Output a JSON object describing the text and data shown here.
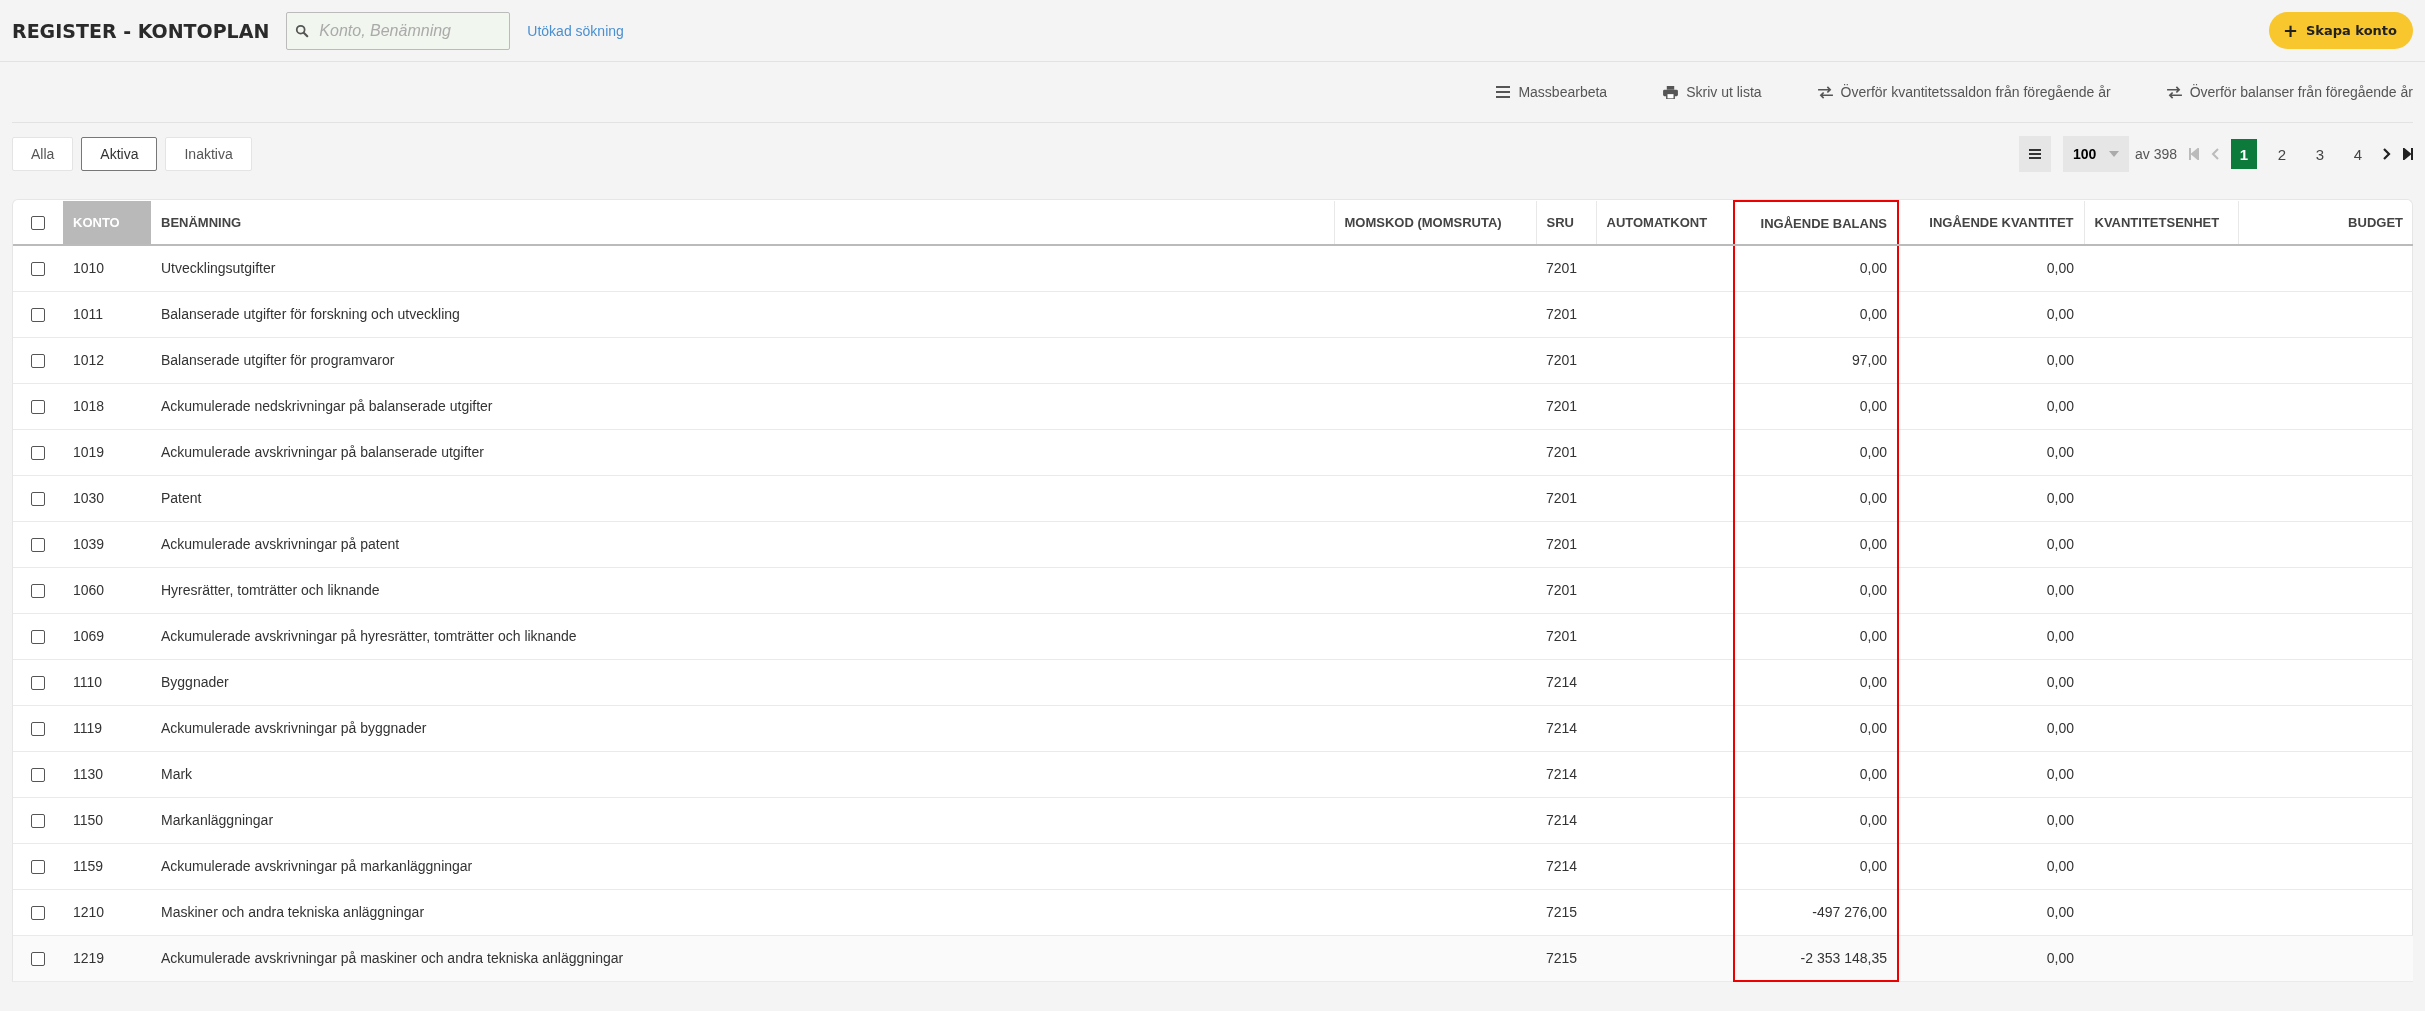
{
  "header": {
    "title": "REGISTER - KONTOPLAN",
    "search": {
      "placeholder": "Konto, Benämning"
    },
    "advanced_search": "Utökad sökning",
    "create_button": {
      "icon": "+",
      "label": "Skapa konto"
    }
  },
  "actions": [
    {
      "kind": "menu",
      "label": "Massbearbeta"
    },
    {
      "kind": "print",
      "label": "Skriv ut lista"
    },
    {
      "kind": "swap",
      "label": "Överför kvantitetssaldon från föregående år"
    },
    {
      "kind": "swap",
      "label": "Överför balanser från föregående år"
    }
  ],
  "filters": [
    {
      "label": "Alla",
      "selected": false
    },
    {
      "label": "Aktiva",
      "selected": true
    },
    {
      "label": "Inaktiva",
      "selected": false
    }
  ],
  "pagination": {
    "page_size": "100",
    "total": "av 398",
    "first_disabled": true,
    "prev_disabled": true,
    "pages": [
      {
        "label": "1",
        "selected": true
      },
      {
        "label": "2",
        "selected": false
      },
      {
        "label": "3",
        "selected": false
      },
      {
        "label": "4",
        "selected": false
      }
    ]
  },
  "table": {
    "columns": [
      {
        "label": "KONTO",
        "sorted": true,
        "kind": "text",
        "highlighted": false
      },
      {
        "label": "BENÄMNING",
        "sorted": false,
        "kind": "text",
        "highlighted": false
      },
      {
        "label": "MOMSKOD (MOMSRUTA)",
        "sorted": false,
        "kind": "text",
        "highlighted": false
      },
      {
        "label": "SRU",
        "sorted": false,
        "kind": "text",
        "highlighted": false
      },
      {
        "label": "AUTOMATKONT",
        "sorted": false,
        "kind": "text",
        "highlighted": false
      },
      {
        "label": "INGÅENDE BALANS",
        "sorted": false,
        "kind": "amount",
        "highlighted": true
      },
      {
        "label": "INGÅENDE KVANTITET",
        "sorted": false,
        "kind": "amount",
        "highlighted": false
      },
      {
        "label": "KVANTITETSENHET",
        "sorted": false,
        "kind": "text",
        "highlighted": false
      },
      {
        "label": "BUDGET",
        "sorted": false,
        "kind": "amount",
        "highlighted": false
      }
    ],
    "select_all_checked": false,
    "rows": [
      {
        "checked": false,
        "cells": [
          "1010",
          "Utvecklingsutgifter",
          "",
          "7201",
          "",
          "0,00",
          "0,00",
          "",
          ""
        ]
      },
      {
        "checked": false,
        "cells": [
          "1011",
          "Balanserade utgifter för forskning och utveckling",
          "",
          "7201",
          "",
          "0,00",
          "0,00",
          "",
          ""
        ]
      },
      {
        "checked": false,
        "cells": [
          "1012",
          "Balanserade utgifter för programvaror",
          "",
          "7201",
          "",
          "97,00",
          "0,00",
          "",
          ""
        ]
      },
      {
        "checked": false,
        "cells": [
          "1018",
          "Ackumulerade nedskrivningar på balanserade utgifter",
          "",
          "7201",
          "",
          "0,00",
          "0,00",
          "",
          ""
        ]
      },
      {
        "checked": false,
        "cells": [
          "1019",
          "Ackumulerade avskrivningar på balanserade utgifter",
          "",
          "7201",
          "",
          "0,00",
          "0,00",
          "",
          ""
        ]
      },
      {
        "checked": false,
        "cells": [
          "1030",
          "Patent",
          "",
          "7201",
          "",
          "0,00",
          "0,00",
          "",
          ""
        ]
      },
      {
        "checked": false,
        "cells": [
          "1039",
          "Ackumulerade avskrivningar på patent",
          "",
          "7201",
          "",
          "0,00",
          "0,00",
          "",
          ""
        ]
      },
      {
        "checked": false,
        "cells": [
          "1060",
          "Hyresrätter, tomträtter och liknande",
          "",
          "7201",
          "",
          "0,00",
          "0,00",
          "",
          ""
        ]
      },
      {
        "checked": false,
        "cells": [
          "1069",
          "Ackumulerade avskrivningar på hyresrätter, tomträtter och liknande",
          "",
          "7201",
          "",
          "0,00",
          "0,00",
          "",
          ""
        ]
      },
      {
        "checked": false,
        "cells": [
          "1110",
          "Byggnader",
          "",
          "7214",
          "",
          "0,00",
          "0,00",
          "",
          ""
        ]
      },
      {
        "checked": false,
        "cells": [
          "1119",
          "Ackumulerade avskrivningar på byggnader",
          "",
          "7214",
          "",
          "0,00",
          "0,00",
          "",
          ""
        ]
      },
      {
        "checked": false,
        "cells": [
          "1130",
          "Mark",
          "",
          "7214",
          "",
          "0,00",
          "0,00",
          "",
          ""
        ]
      },
      {
        "checked": false,
        "cells": [
          "1150",
          "Markanläggningar",
          "",
          "7214",
          "",
          "0,00",
          "0,00",
          "",
          ""
        ]
      },
      {
        "checked": false,
        "cells": [
          "1159",
          "Ackumulerade avskrivningar på markanläggningar",
          "",
          "7214",
          "",
          "0,00",
          "0,00",
          "",
          ""
        ]
      },
      {
        "checked": false,
        "cells": [
          "1210",
          "Maskiner och andra tekniska anläggningar",
          "",
          "7215",
          "",
          "-497 276,00",
          "0,00",
          "",
          ""
        ]
      },
      {
        "checked": false,
        "cells": [
          "1219",
          "Ackumulerade avskrivningar på maskiner och andra tekniska anläggningar",
          "",
          "7215",
          "",
          "-2 353 148,35",
          "0,00",
          "",
          ""
        ]
      }
    ]
  }
}
